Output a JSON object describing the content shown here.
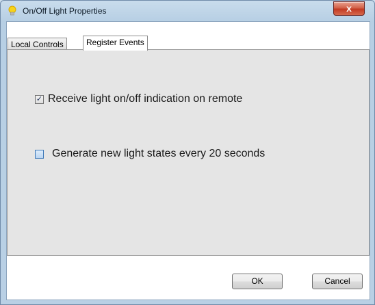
{
  "window": {
    "title": "On/Off Light Properties",
    "title_icon": "lightbulb-icon",
    "close_glyph": "x",
    "close_color": "#c7432b"
  },
  "tabs": [
    {
      "label": "Local Controls",
      "selected": false
    },
    {
      "label": "Register Events",
      "selected": true
    }
  ],
  "options": {
    "receive_indication": {
      "label": "Receive light on/off indication on remote",
      "checked": true
    },
    "generate_states": {
      "label": "Generate new light states every 20 seconds",
      "checked": false
    }
  },
  "buttons": {
    "ok_label": "OK",
    "cancel_label": "Cancel"
  },
  "colors": {
    "accent": "#3d78b8",
    "panel_background": "#e5e5e5",
    "bulb": "#f7d31a"
  }
}
